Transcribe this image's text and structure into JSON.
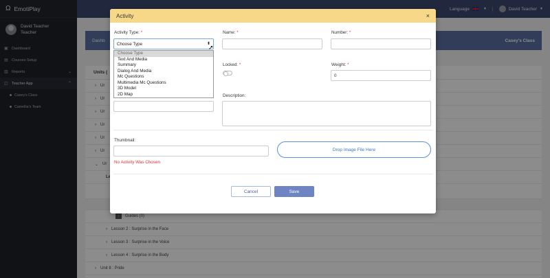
{
  "app": {
    "logo_glyph": "Ω",
    "name": "EmotiPlay"
  },
  "profile": {
    "name": "David Teacher",
    "role": "Teacher"
  },
  "sidebar": {
    "items": [
      {
        "icon": "dashboard-icon",
        "label": "Dashboard"
      },
      {
        "icon": "courses-icon",
        "label": "Courses Setup"
      },
      {
        "icon": "reports-icon",
        "label": "Reports"
      },
      {
        "icon": "teacher-icon",
        "label": "Teacher App"
      }
    ],
    "subitems": [
      "Casey's Class",
      "Camellia's Team"
    ]
  },
  "topbar": {
    "language_label": "Language",
    "user_name": "David Teacher"
  },
  "background": {
    "breadcrumb": "Dashb",
    "class_name": "Casey's Class",
    "units_title": "Units (",
    "rows": [
      "Ur",
      "Ur",
      "Ur",
      "Ur",
      "Ur",
      "Ur",
      "Ur"
    ],
    "lesson_label": "Le",
    "guides": "Guides (0)",
    "lessons": [
      "Lesson 2 : Surprise in the Face",
      "Lesson 3 : Surprise in the Voice",
      "Lesson 4 : Surprise in the Body"
    ],
    "unit8": "Unit 8 : Pride"
  },
  "modal": {
    "title": "Activity",
    "close_glyph": "×",
    "activity_type_label": "Activity Type:",
    "activity_type_value": "Choose Type",
    "activity_type_options": [
      "Choose Type",
      "Text And Media",
      "Summary",
      "Dialog And Media",
      "Mc Questions",
      "Multimedia Mc Questions",
      "3D Model",
      "2D Map"
    ],
    "name_label": "Name:",
    "name_value": "",
    "number_label": "Number:",
    "number_value": "",
    "locked_label": "Locked:",
    "weight_label": "Weight:",
    "weight_value": "0",
    "description_label": "Description:",
    "thumbnail_label": "Thumbnail:",
    "drop_label": "Drop Image File Here",
    "error_text": "No Activity Was Chosen",
    "cancel_label": "Cancel",
    "save_label": "Save",
    "required_mark": "*"
  }
}
